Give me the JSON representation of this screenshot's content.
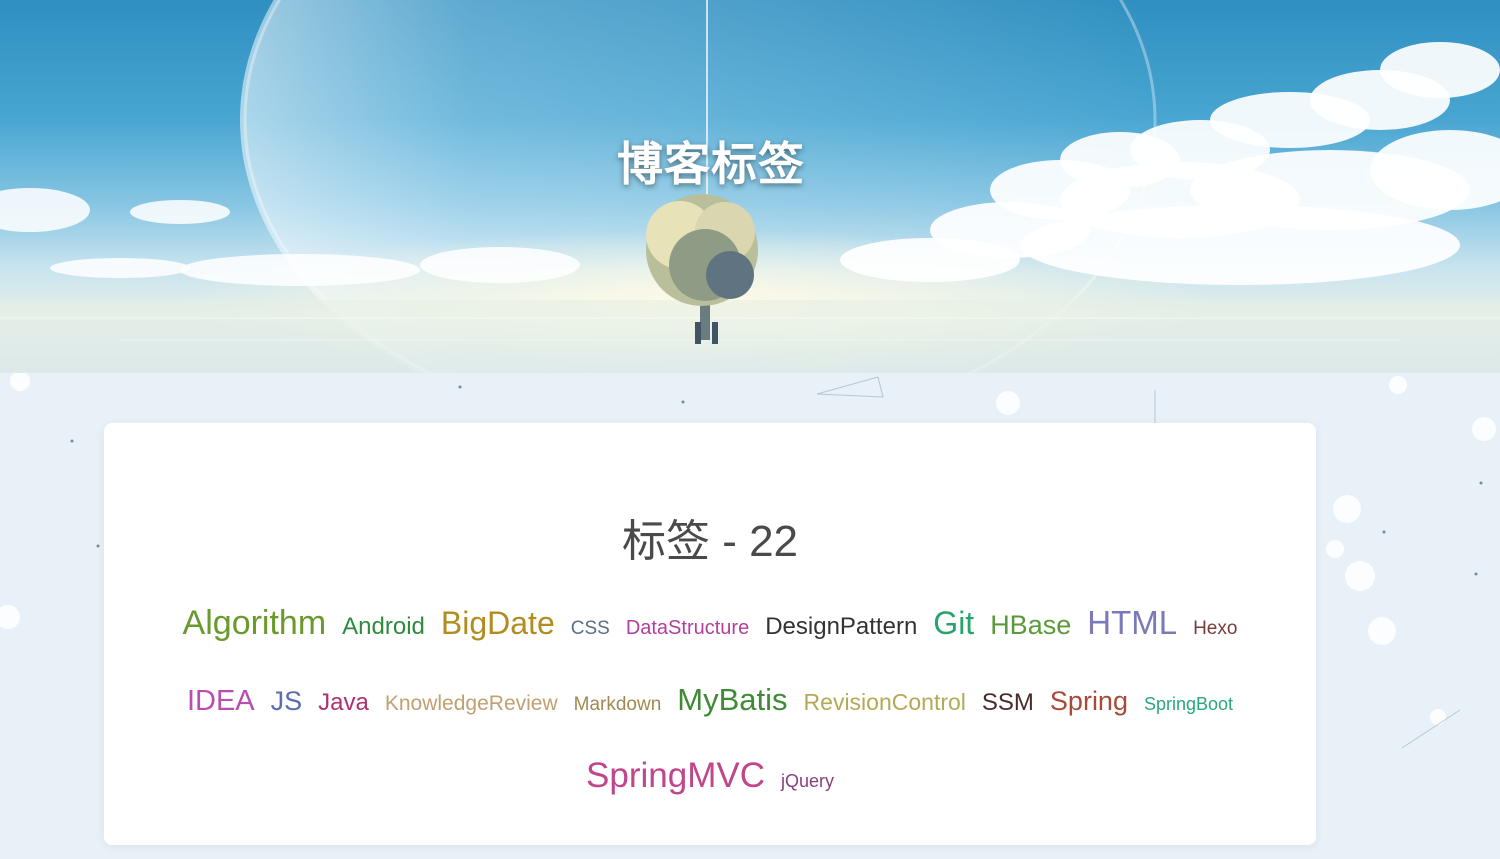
{
  "hero": {
    "title": "博客标签"
  },
  "card": {
    "heading": "标签 - 22"
  },
  "tags": [
    {
      "label": "Algorithm",
      "size": 34,
      "color": "#6a9a2c"
    },
    {
      "label": "Android",
      "size": 24,
      "color": "#2e8b3e"
    },
    {
      "label": "BigDate",
      "size": 32,
      "color": "#b08d1e"
    },
    {
      "label": "CSS",
      "size": 19,
      "color": "#5b6f86"
    },
    {
      "label": "DataStructure",
      "size": 20,
      "color": "#b23f9e"
    },
    {
      "label": "DesignPattern",
      "size": 24,
      "color": "#333333"
    },
    {
      "label": "Git",
      "size": 32,
      "color": "#27a46a"
    },
    {
      "label": "HBase",
      "size": 27,
      "color": "#5a9a3a"
    },
    {
      "label": "HTML",
      "size": 33,
      "color": "#7a7ab8"
    },
    {
      "label": "Hexo",
      "size": 19,
      "color": "#7a3b3b"
    },
    {
      "label": "IDEA",
      "size": 29,
      "color": "#b84fb0"
    },
    {
      "label": "JS",
      "size": 27,
      "color": "#5a6eae"
    },
    {
      "label": "Java",
      "size": 24,
      "color": "#b0306e"
    },
    {
      "label": "KnowledgeReview",
      "size": 21,
      "color": "#c0a070"
    },
    {
      "label": "Markdown",
      "size": 19,
      "color": "#a08a50"
    },
    {
      "label": "MyBatis",
      "size": 31,
      "color": "#3f8a35"
    },
    {
      "label": "RevisionControl",
      "size": 23,
      "color": "#b4aa55"
    },
    {
      "label": "SSM",
      "size": 24,
      "color": "#4a2a2a"
    },
    {
      "label": "Spring",
      "size": 27,
      "color": "#a84a3a"
    },
    {
      "label": "SpringBoot",
      "size": 18,
      "color": "#2aa87a"
    },
    {
      "label": "SpringMVC",
      "size": 35,
      "color": "#c0458a"
    },
    {
      "label": "jQuery",
      "size": 18,
      "color": "#8a3f7a"
    }
  ]
}
